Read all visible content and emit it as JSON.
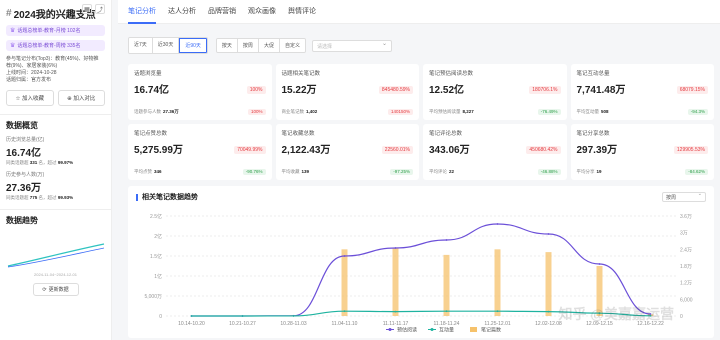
{
  "sidebar": {
    "title_hash": "#",
    "title": "2024我的兴趣支点",
    "rank_tags": [
      "话题总榜单-教育-月榜 102名",
      "话题总榜单-教育-周榜 335名"
    ],
    "meta_lines": [
      "参与笔记分布(Top3)：教育(45%)、好物推",
      "荐(9%)、家居家装(6%)",
      "上线时间：2024-10-28",
      "话题归属：官方发布"
    ],
    "add_favorite": "加入收藏",
    "add_compare": "加入对比",
    "overview_title": "数据概览",
    "views_label": "历史浏览总量(亿)",
    "views_value": "16.74亿",
    "views_sub_prefix": "同类话题超",
    "views_sub_value": "331",
    "views_sub_mid": "名，超过",
    "views_sub_pct": "99.97%",
    "participants_label": "历史参与人数(万)",
    "participants_value": "27.36万",
    "participants_sub_prefix": "同类话题超",
    "participants_sub_value": "775",
    "participants_sub_mid": "名，超过",
    "participants_sub_pct": "99.93%",
    "trend_title": "数据趋势",
    "mini_label": "2024-11-04~2024-12-01",
    "refresh": "更新数据"
  },
  "tabs": [
    "笔记分析",
    "达人分析",
    "品牌营销",
    "观众画像",
    "舆情评论"
  ],
  "active_tab": 0,
  "date_ranges": [
    "近7天",
    "近30天",
    "近90天"
  ],
  "active_range": 2,
  "granularity": [
    "按天",
    "按周",
    "大促",
    "自定义"
  ],
  "date_picker_placeholder": "请选择",
  "cards": [
    {
      "label": "话题浏览量",
      "value": "16.74亿",
      "pct": "100%",
      "dir": "up",
      "foot_label": "话题参与人数",
      "foot_value": "27.36万",
      "foot_pct": "100%",
      "foot_dir": "up"
    },
    {
      "label": "话题相关笔记数",
      "value": "15.22万",
      "pct": "845480.59%",
      "dir": "up",
      "foot_label": "商业笔记数",
      "foot_value": "1,402",
      "foot_pct": "140150%",
      "foot_dir": "up"
    },
    {
      "label": "笔记预估阅读总数",
      "value": "12.52亿",
      "pct": "180706.1%",
      "dir": "up",
      "foot_label": "平均预估阅读量",
      "foot_value": "8,227",
      "foot_pct": "-76.49%",
      "foot_dir": "down"
    },
    {
      "label": "笔记互动总量",
      "value": "7,741.48万",
      "pct": "68079.15%",
      "dir": "up",
      "foot_label": "平均互动量",
      "foot_value": "508",
      "foot_pct": "-94.3%",
      "foot_dir": "down"
    },
    {
      "label": "笔记点赞总数",
      "value": "5,275.99万",
      "pct": "70049.99%",
      "dir": "up",
      "foot_label": "平均点赞",
      "foot_value": "346",
      "foot_pct": "-90.76%",
      "foot_dir": "down"
    },
    {
      "label": "笔记收藏总数",
      "value": "2,122.43万",
      "pct": "22560.01%",
      "dir": "up",
      "foot_label": "平均收藏",
      "foot_value": "139",
      "foot_pct": "-97.25%",
      "foot_dir": "down"
    },
    {
      "label": "笔记评论总数",
      "value": "343.06万",
      "pct": "450680.42%",
      "dir": "up",
      "foot_label": "平均评论",
      "foot_value": "22",
      "foot_pct": "-46.88%",
      "foot_dir": "down"
    },
    {
      "label": "笔记分享总数",
      "value": "297.39万",
      "pct": "129905.53%",
      "dir": "up",
      "foot_label": "平均分享",
      "foot_value": "19",
      "foot_pct": "-84.62%",
      "foot_dir": "down"
    }
  ],
  "chart_section": {
    "title": "相关笔记数据趋势",
    "selector": "按周"
  },
  "chart_data": {
    "type": "line",
    "categories": [
      "10.14-10.20",
      "10.21-10.27",
      "10.28-11.03",
      "11.04-11.10",
      "11.11-11.17",
      "11.18-11.24",
      "11.25-12.01",
      "12.02-12.08",
      "12.09-12.15",
      "12.16-12.22"
    ],
    "left_axis_ticks": [
      "2.5亿",
      "2亿",
      "1.5亿",
      "1亿",
      "5,000万",
      "0"
    ],
    "right_axis_ticks": [
      "3.6万",
      "3万",
      "2.4万",
      "1.8万",
      "1.2万",
      "6,000",
      "0"
    ],
    "series": [
      {
        "name": "预估阅读",
        "color": "#6b4fd8",
        "type": "line",
        "axis": "left",
        "values": [
          0,
          0,
          500000,
          150000000,
          170000000,
          190000000,
          230000000,
          205000000,
          130000000,
          5000000
        ]
      },
      {
        "name": "互动量",
        "color": "#1fb3a0",
        "type": "line",
        "axis": "left",
        "values": [
          0,
          0,
          200000,
          12000000,
          11000000,
          12000000,
          12000000,
          11000000,
          7000000,
          500000
        ]
      },
      {
        "name": "笔记篇数",
        "color": "#f6c26b",
        "type": "bar",
        "axis": "right",
        "values": [
          0,
          0,
          300,
          24000,
          24500,
          22000,
          24000,
          23000,
          18000,
          600
        ]
      }
    ],
    "ylim_left": [
      0,
      250000000
    ],
    "ylim_right": [
      0,
      36000
    ],
    "legend_position": "bottom-center"
  },
  "watermark": "知乎 @美嘉嘉运营"
}
